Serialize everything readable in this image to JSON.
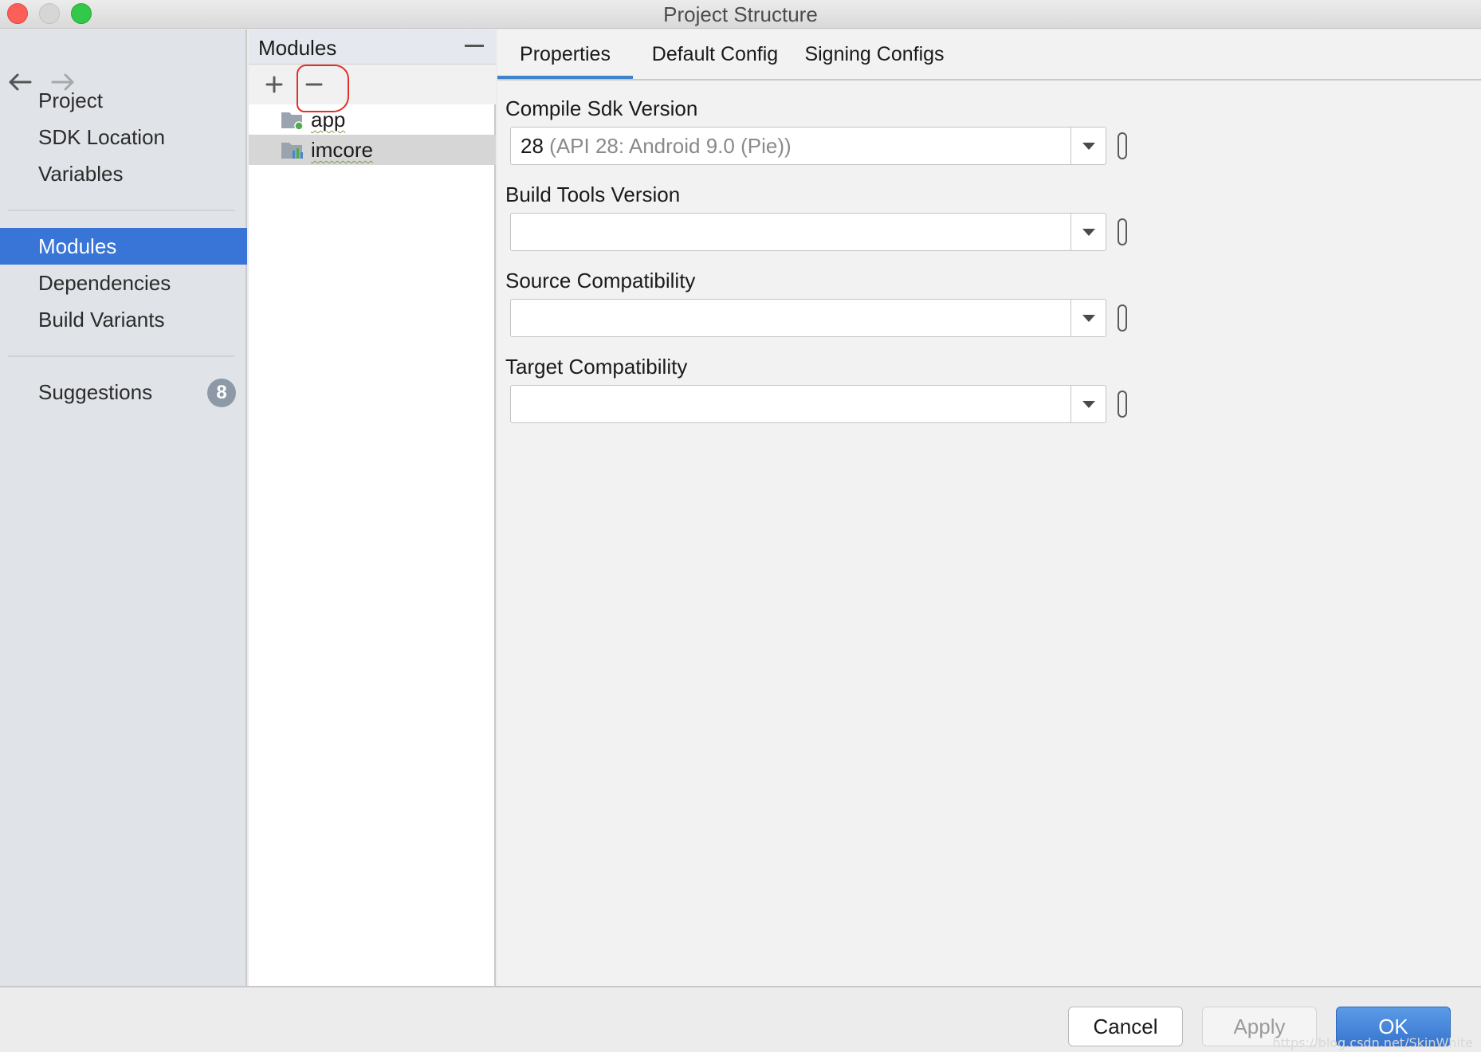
{
  "window": {
    "title": "Project Structure"
  },
  "nav": {
    "back_icon": "arrow-left-icon",
    "forward_icon": "arrow-right-icon"
  },
  "sidebar": {
    "group1": [
      "Project",
      "SDK Location",
      "Variables"
    ],
    "group2": [
      "Modules",
      "Dependencies",
      "Build Variants"
    ],
    "selected": "Modules",
    "suggestions": {
      "label": "Suggestions",
      "count": "8"
    }
  },
  "modules": {
    "title": "Modules",
    "items": [
      {
        "name": "app",
        "icon": "app-module-icon"
      },
      {
        "name": "imcore",
        "icon": "library-module-icon"
      }
    ],
    "selected": "imcore"
  },
  "tabs": [
    {
      "label": "Properties",
      "active": true
    },
    {
      "label": "Default Config",
      "active": false
    },
    {
      "label": "Signing Configs",
      "active": false
    }
  ],
  "properties": {
    "compile_sdk": {
      "label": "Compile Sdk Version",
      "value": "28",
      "detail": "(API 28: Android 9.0 (Pie))"
    },
    "build_tools": {
      "label": "Build Tools Version",
      "value": ""
    },
    "source_compat": {
      "label": "Source Compatibility",
      "value": ""
    },
    "target_compat": {
      "label": "Target Compatibility",
      "value": ""
    }
  },
  "footer": {
    "cancel": "Cancel",
    "apply": "Apply",
    "ok": "OK",
    "watermark": "https://blog.csdn.net/SkinWhite"
  },
  "colors": {
    "accent": "#3875d6",
    "annotation": "#e0302a",
    "tab_indicator": "#4083c9"
  }
}
